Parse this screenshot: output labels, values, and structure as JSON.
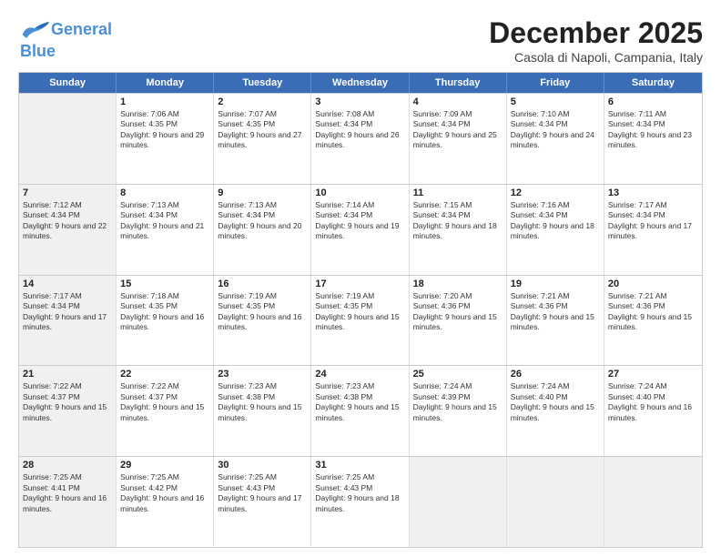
{
  "header": {
    "logo_general": "General",
    "logo_blue": "Blue",
    "month_title": "December 2025",
    "subtitle": "Casola di Napoli, Campania, Italy"
  },
  "weekdays": [
    "Sunday",
    "Monday",
    "Tuesday",
    "Wednesday",
    "Thursday",
    "Friday",
    "Saturday"
  ],
  "rows": [
    [
      {
        "day": "",
        "sunrise": "",
        "sunset": "",
        "daylight": "",
        "shaded": true
      },
      {
        "day": "1",
        "sunrise": "Sunrise: 7:06 AM",
        "sunset": "Sunset: 4:35 PM",
        "daylight": "Daylight: 9 hours and 29 minutes.",
        "shaded": false
      },
      {
        "day": "2",
        "sunrise": "Sunrise: 7:07 AM",
        "sunset": "Sunset: 4:35 PM",
        "daylight": "Daylight: 9 hours and 27 minutes.",
        "shaded": false
      },
      {
        "day": "3",
        "sunrise": "Sunrise: 7:08 AM",
        "sunset": "Sunset: 4:34 PM",
        "daylight": "Daylight: 9 hours and 26 minutes.",
        "shaded": false
      },
      {
        "day": "4",
        "sunrise": "Sunrise: 7:09 AM",
        "sunset": "Sunset: 4:34 PM",
        "daylight": "Daylight: 9 hours and 25 minutes.",
        "shaded": false
      },
      {
        "day": "5",
        "sunrise": "Sunrise: 7:10 AM",
        "sunset": "Sunset: 4:34 PM",
        "daylight": "Daylight: 9 hours and 24 minutes.",
        "shaded": false
      },
      {
        "day": "6",
        "sunrise": "Sunrise: 7:11 AM",
        "sunset": "Sunset: 4:34 PM",
        "daylight": "Daylight: 9 hours and 23 minutes.",
        "shaded": false
      }
    ],
    [
      {
        "day": "7",
        "sunrise": "Sunrise: 7:12 AM",
        "sunset": "Sunset: 4:34 PM",
        "daylight": "Daylight: 9 hours and 22 minutes.",
        "shaded": true
      },
      {
        "day": "8",
        "sunrise": "Sunrise: 7:13 AM",
        "sunset": "Sunset: 4:34 PM",
        "daylight": "Daylight: 9 hours and 21 minutes.",
        "shaded": false
      },
      {
        "day": "9",
        "sunrise": "Sunrise: 7:13 AM",
        "sunset": "Sunset: 4:34 PM",
        "daylight": "Daylight: 9 hours and 20 minutes.",
        "shaded": false
      },
      {
        "day": "10",
        "sunrise": "Sunrise: 7:14 AM",
        "sunset": "Sunset: 4:34 PM",
        "daylight": "Daylight: 9 hours and 19 minutes.",
        "shaded": false
      },
      {
        "day": "11",
        "sunrise": "Sunrise: 7:15 AM",
        "sunset": "Sunset: 4:34 PM",
        "daylight": "Daylight: 9 hours and 18 minutes.",
        "shaded": false
      },
      {
        "day": "12",
        "sunrise": "Sunrise: 7:16 AM",
        "sunset": "Sunset: 4:34 PM",
        "daylight": "Daylight: 9 hours and 18 minutes.",
        "shaded": false
      },
      {
        "day": "13",
        "sunrise": "Sunrise: 7:17 AM",
        "sunset": "Sunset: 4:34 PM",
        "daylight": "Daylight: 9 hours and 17 minutes.",
        "shaded": false
      }
    ],
    [
      {
        "day": "14",
        "sunrise": "Sunrise: 7:17 AM",
        "sunset": "Sunset: 4:34 PM",
        "daylight": "Daylight: 9 hours and 17 minutes.",
        "shaded": true
      },
      {
        "day": "15",
        "sunrise": "Sunrise: 7:18 AM",
        "sunset": "Sunset: 4:35 PM",
        "daylight": "Daylight: 9 hours and 16 minutes.",
        "shaded": false
      },
      {
        "day": "16",
        "sunrise": "Sunrise: 7:19 AM",
        "sunset": "Sunset: 4:35 PM",
        "daylight": "Daylight: 9 hours and 16 minutes.",
        "shaded": false
      },
      {
        "day": "17",
        "sunrise": "Sunrise: 7:19 AM",
        "sunset": "Sunset: 4:35 PM",
        "daylight": "Daylight: 9 hours and 15 minutes.",
        "shaded": false
      },
      {
        "day": "18",
        "sunrise": "Sunrise: 7:20 AM",
        "sunset": "Sunset: 4:36 PM",
        "daylight": "Daylight: 9 hours and 15 minutes.",
        "shaded": false
      },
      {
        "day": "19",
        "sunrise": "Sunrise: 7:21 AM",
        "sunset": "Sunset: 4:36 PM",
        "daylight": "Daylight: 9 hours and 15 minutes.",
        "shaded": false
      },
      {
        "day": "20",
        "sunrise": "Sunrise: 7:21 AM",
        "sunset": "Sunset: 4:36 PM",
        "daylight": "Daylight: 9 hours and 15 minutes.",
        "shaded": false
      }
    ],
    [
      {
        "day": "21",
        "sunrise": "Sunrise: 7:22 AM",
        "sunset": "Sunset: 4:37 PM",
        "daylight": "Daylight: 9 hours and 15 minutes.",
        "shaded": true
      },
      {
        "day": "22",
        "sunrise": "Sunrise: 7:22 AM",
        "sunset": "Sunset: 4:37 PM",
        "daylight": "Daylight: 9 hours and 15 minutes.",
        "shaded": false
      },
      {
        "day": "23",
        "sunrise": "Sunrise: 7:23 AM",
        "sunset": "Sunset: 4:38 PM",
        "daylight": "Daylight: 9 hours and 15 minutes.",
        "shaded": false
      },
      {
        "day": "24",
        "sunrise": "Sunrise: 7:23 AM",
        "sunset": "Sunset: 4:38 PM",
        "daylight": "Daylight: 9 hours and 15 minutes.",
        "shaded": false
      },
      {
        "day": "25",
        "sunrise": "Sunrise: 7:24 AM",
        "sunset": "Sunset: 4:39 PM",
        "daylight": "Daylight: 9 hours and 15 minutes.",
        "shaded": false
      },
      {
        "day": "26",
        "sunrise": "Sunrise: 7:24 AM",
        "sunset": "Sunset: 4:40 PM",
        "daylight": "Daylight: 9 hours and 15 minutes.",
        "shaded": false
      },
      {
        "day": "27",
        "sunrise": "Sunrise: 7:24 AM",
        "sunset": "Sunset: 4:40 PM",
        "daylight": "Daylight: 9 hours and 16 minutes.",
        "shaded": false
      }
    ],
    [
      {
        "day": "28",
        "sunrise": "Sunrise: 7:25 AM",
        "sunset": "Sunset: 4:41 PM",
        "daylight": "Daylight: 9 hours and 16 minutes.",
        "shaded": true
      },
      {
        "day": "29",
        "sunrise": "Sunrise: 7:25 AM",
        "sunset": "Sunset: 4:42 PM",
        "daylight": "Daylight: 9 hours and 16 minutes.",
        "shaded": false
      },
      {
        "day": "30",
        "sunrise": "Sunrise: 7:25 AM",
        "sunset": "Sunset: 4:43 PM",
        "daylight": "Daylight: 9 hours and 17 minutes.",
        "shaded": false
      },
      {
        "day": "31",
        "sunrise": "Sunrise: 7:25 AM",
        "sunset": "Sunset: 4:43 PM",
        "daylight": "Daylight: 9 hours and 18 minutes.",
        "shaded": false
      },
      {
        "day": "",
        "sunrise": "",
        "sunset": "",
        "daylight": "",
        "shaded": true
      },
      {
        "day": "",
        "sunrise": "",
        "sunset": "",
        "daylight": "",
        "shaded": true
      },
      {
        "day": "",
        "sunrise": "",
        "sunset": "",
        "daylight": "",
        "shaded": true
      }
    ]
  ]
}
